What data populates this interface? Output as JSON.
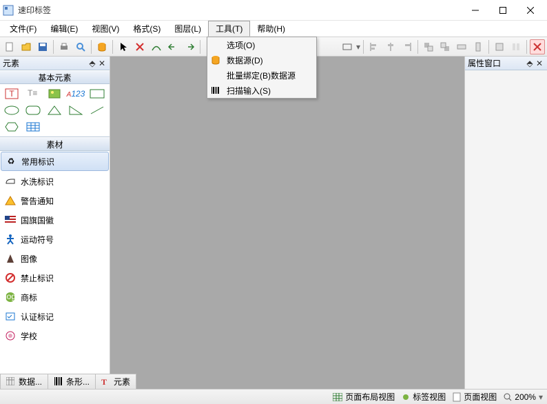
{
  "app": {
    "title": "速印标签"
  },
  "menu": {
    "file": "文件(F)",
    "edit": "编辑(E)",
    "view": "视图(V)",
    "format": "格式(S)",
    "layer": "图层(L)",
    "tools": "工具(T)",
    "help": "帮助(H)"
  },
  "tools_menu": {
    "options": "选项(O)",
    "datasource": "数据源(D)",
    "batchbind": "批量绑定(B)数据源",
    "scaninput": "扫描输入(S)"
  },
  "panels": {
    "elements_title": "元素",
    "basic_header": "基本元素",
    "materials_header": "素材",
    "properties_title": "属性窗口"
  },
  "materials": [
    "常用标识",
    "水洗标识",
    "警告通知",
    "国旗国徽",
    "运动符号",
    "图像",
    "禁止标识",
    "商标",
    "认证标记",
    "学校"
  ],
  "bottom_tabs": {
    "data": "数据...",
    "barcode": "条形...",
    "element": "元素"
  },
  "status": {
    "layout_view": "页面布局视图",
    "label_view": "标签视图",
    "page_view": "页面视图",
    "zoom": "200%"
  }
}
